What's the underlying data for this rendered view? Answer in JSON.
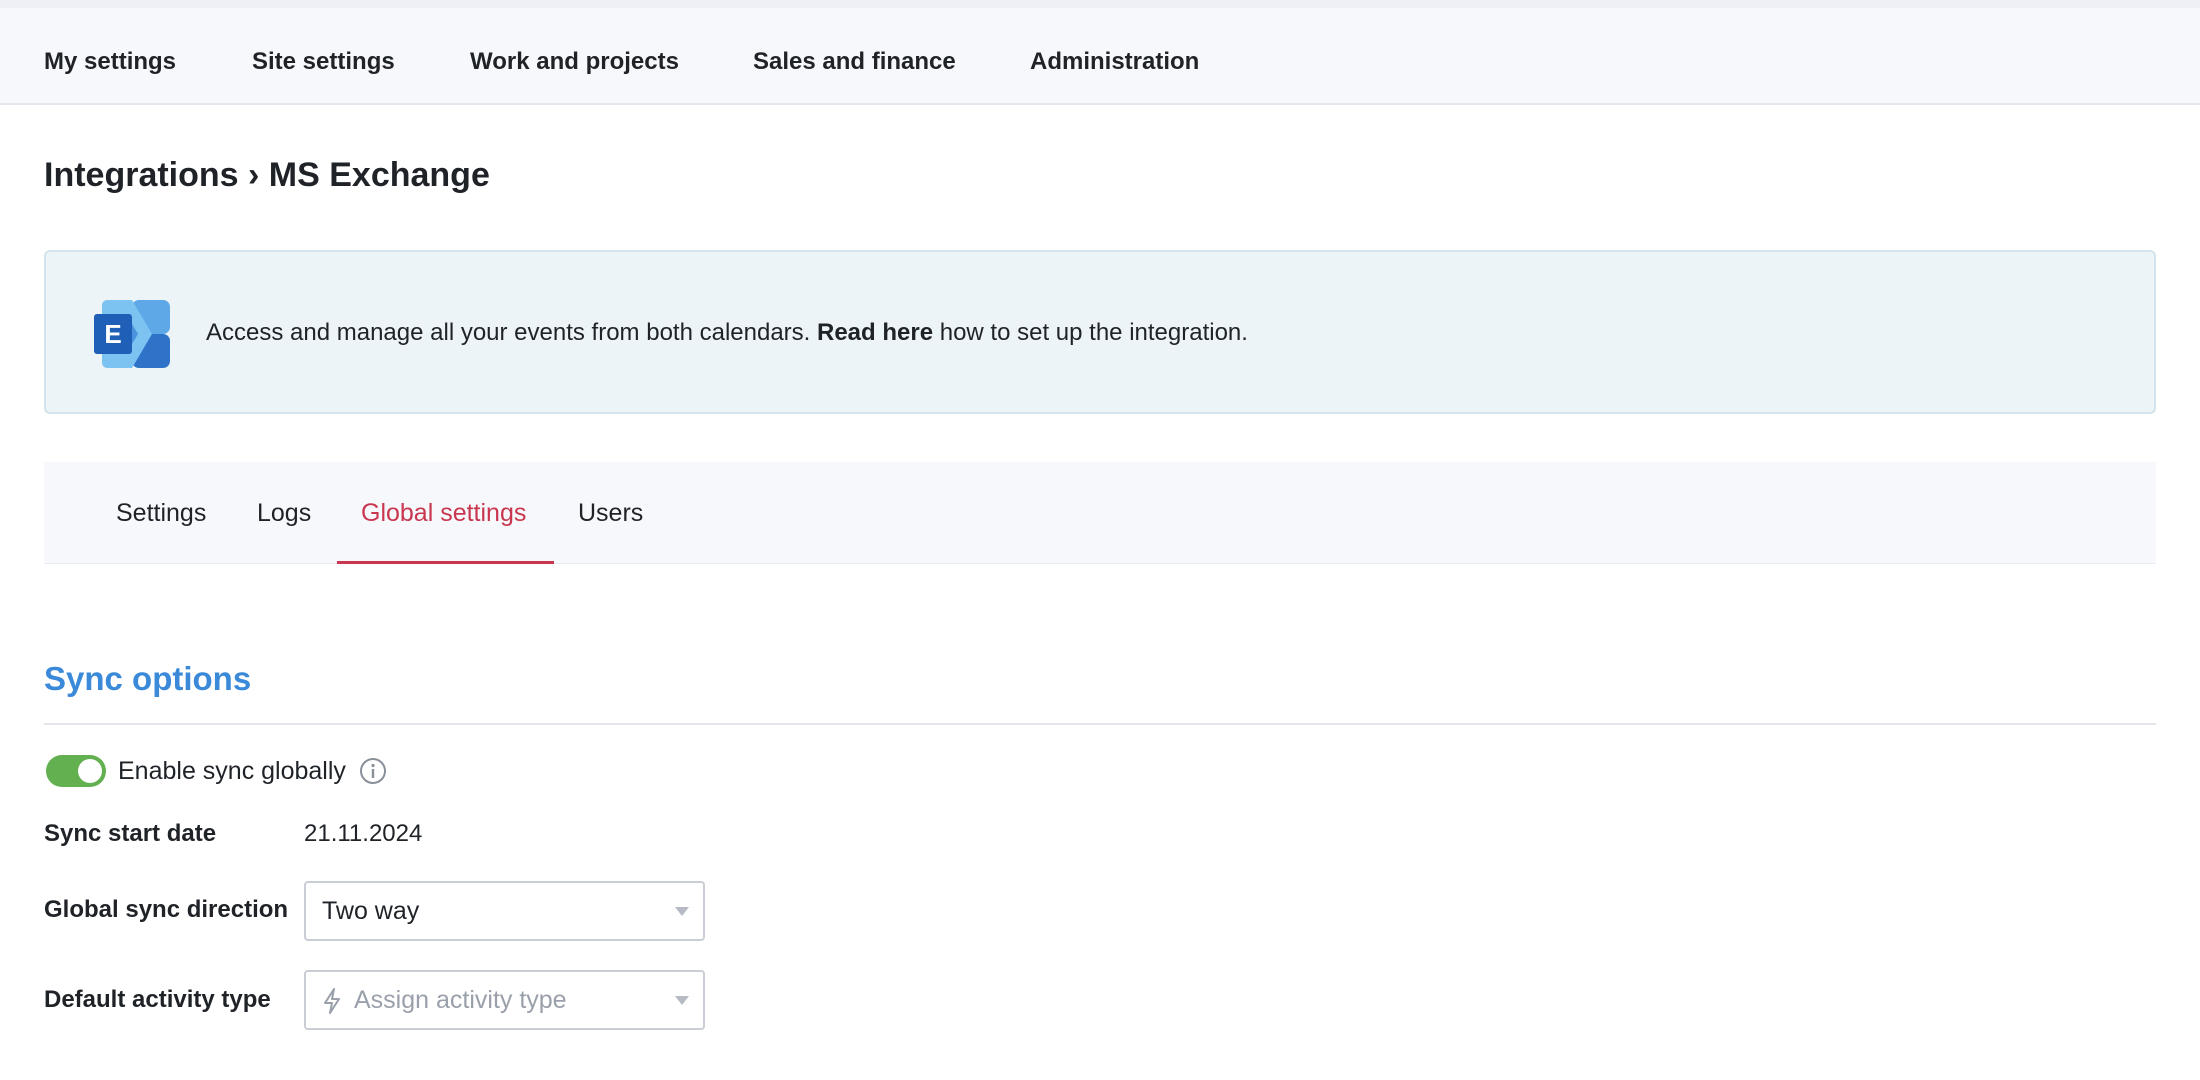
{
  "topnav": {
    "items": [
      {
        "label": "My settings"
      },
      {
        "label": "Site settings"
      },
      {
        "label": "Work and projects"
      },
      {
        "label": "Sales and finance"
      },
      {
        "label": "Administration"
      }
    ]
  },
  "page": {
    "title": "Integrations › MS Exchange"
  },
  "banner": {
    "icon": "ms-exchange-logo",
    "logo_letter": "E",
    "text_before": "Access and manage all your events from both calendars. ",
    "link_label": "Read here",
    "text_after": " how to set up the integration."
  },
  "tabs": {
    "items": [
      {
        "label": "Settings",
        "active": false
      },
      {
        "label": "Logs",
        "active": false
      },
      {
        "label": "Global settings",
        "active": true
      },
      {
        "label": "Users",
        "active": false
      }
    ]
  },
  "sync": {
    "section_title": "Sync options",
    "enable_label": "Enable sync globally",
    "enabled": true,
    "start_date_label": "Sync start date",
    "start_date_value": "21.11.2024",
    "direction_label": "Global sync direction",
    "direction_value": "Two way",
    "activity_label": "Default activity type",
    "activity_placeholder": "Assign activity type"
  },
  "colors": {
    "accent_blue": "#3a8ad9",
    "active_tab_red": "#c8374f",
    "toggle_green": "#62b04f",
    "banner_bg": "#ecf4f8"
  }
}
